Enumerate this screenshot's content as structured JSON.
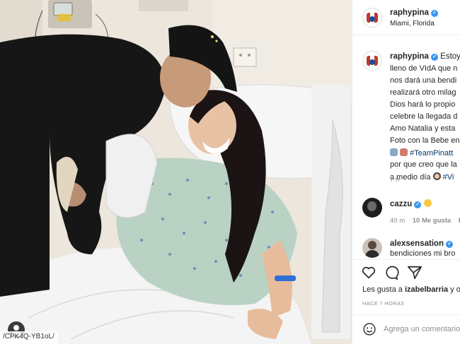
{
  "photo": {
    "url_fragment": "/CPK4Q-YB1oL/",
    "user_tag_icon": "person-icon"
  },
  "post": {
    "author": "raphypina",
    "verified": true,
    "location": "Miami, Florida"
  },
  "caption": {
    "author": "raphypina",
    "lines": [
      "Estoy",
      "lleno de VIdA que n",
      "nos dará una bendi",
      "realizará otro milag",
      "Dios hará lo propio",
      "celebre la llegada d",
      "Amo Natalia y esta",
      "Foto con la Bebe en",
      "#TeamPinatt",
      "por que creo que la",
      "a medio día",
      "#Vi"
    ],
    "time": "7 h"
  },
  "comments": [
    {
      "author": "cazzu",
      "verified": true,
      "time": "40 m",
      "likes": "10 Me gusta",
      "reply": "R"
    },
    {
      "author": "alexsensation",
      "verified": true,
      "text": "bendiciones mi bro"
    }
  ],
  "actions": {
    "like_icon": "heart-icon",
    "comment_icon": "comment-icon",
    "share_icon": "send-icon"
  },
  "likes": {
    "prefix": "Les gusta a",
    "user": "izabelbarria",
    "suffix": "y o"
  },
  "timestamp": "HACE 7 HORAS",
  "comment_box": {
    "placeholder": "Agrega un comentario"
  }
}
